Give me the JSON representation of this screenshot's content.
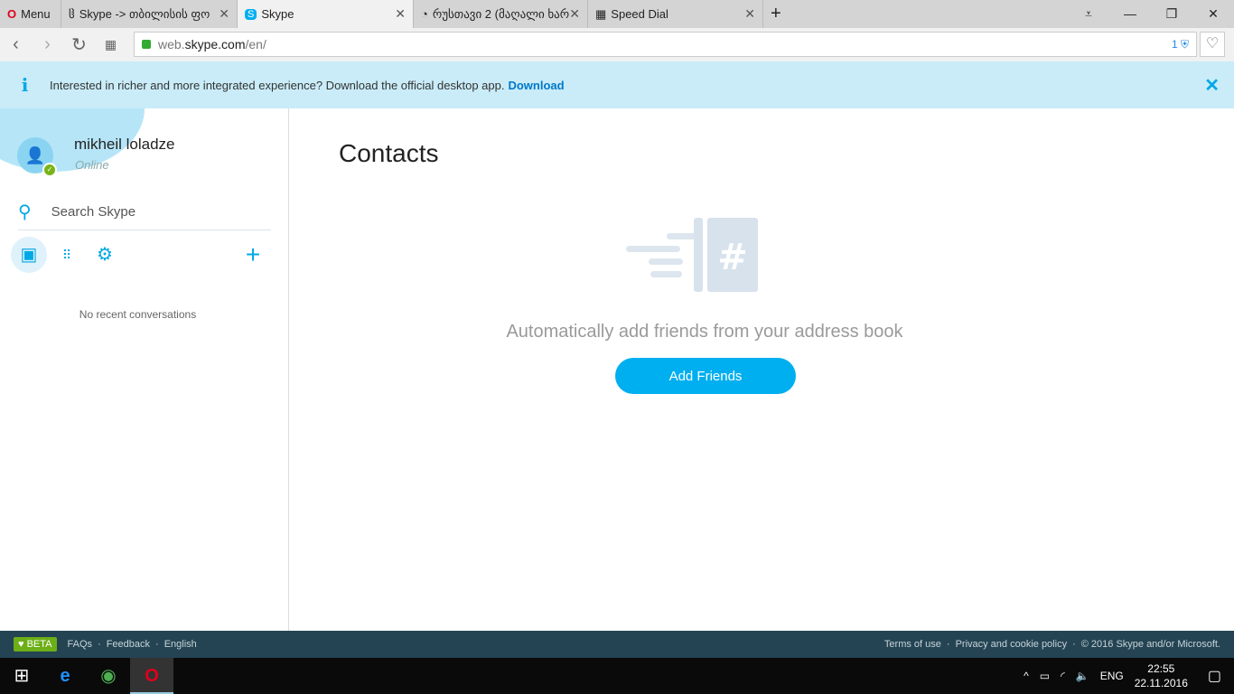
{
  "browser": {
    "menu_label": "Menu",
    "tabs": [
      {
        "title": "Skype -> თბილისის ფო"
      },
      {
        "title": "Skype"
      },
      {
        "title": "რუსთავი 2 (მაღალი ხარ"
      },
      {
        "title": "Speed Dial"
      }
    ],
    "url_prefix": "web.",
    "url_domain": "skype.com",
    "url_path": "/en/",
    "badge_count": "1"
  },
  "banner": {
    "text": "Interested in richer and more integrated experience? Download the official desktop app.",
    "link": "Download"
  },
  "profile": {
    "name": "mikheil loladze",
    "status": "Online"
  },
  "search": {
    "placeholder": "Search Skype"
  },
  "sidebar": {
    "empty": "No recent conversations"
  },
  "main": {
    "title": "Contacts",
    "hint": "Automatically add friends from your address book",
    "button": "Add Friends"
  },
  "footer": {
    "beta": "BETA",
    "left": [
      "FAQs",
      "Feedback",
      "English"
    ],
    "right": [
      "Terms of use",
      "Privacy and cookie policy",
      "© 2016 Skype and/or Microsoft."
    ]
  },
  "taskbar": {
    "lang": "ENG",
    "time": "22:55",
    "date": "22.11.2016"
  },
  "colors": {
    "accent": "#00aff0",
    "banner": "#c9ecf8",
    "footer": "#244454",
    "beta": "#6caf17"
  }
}
